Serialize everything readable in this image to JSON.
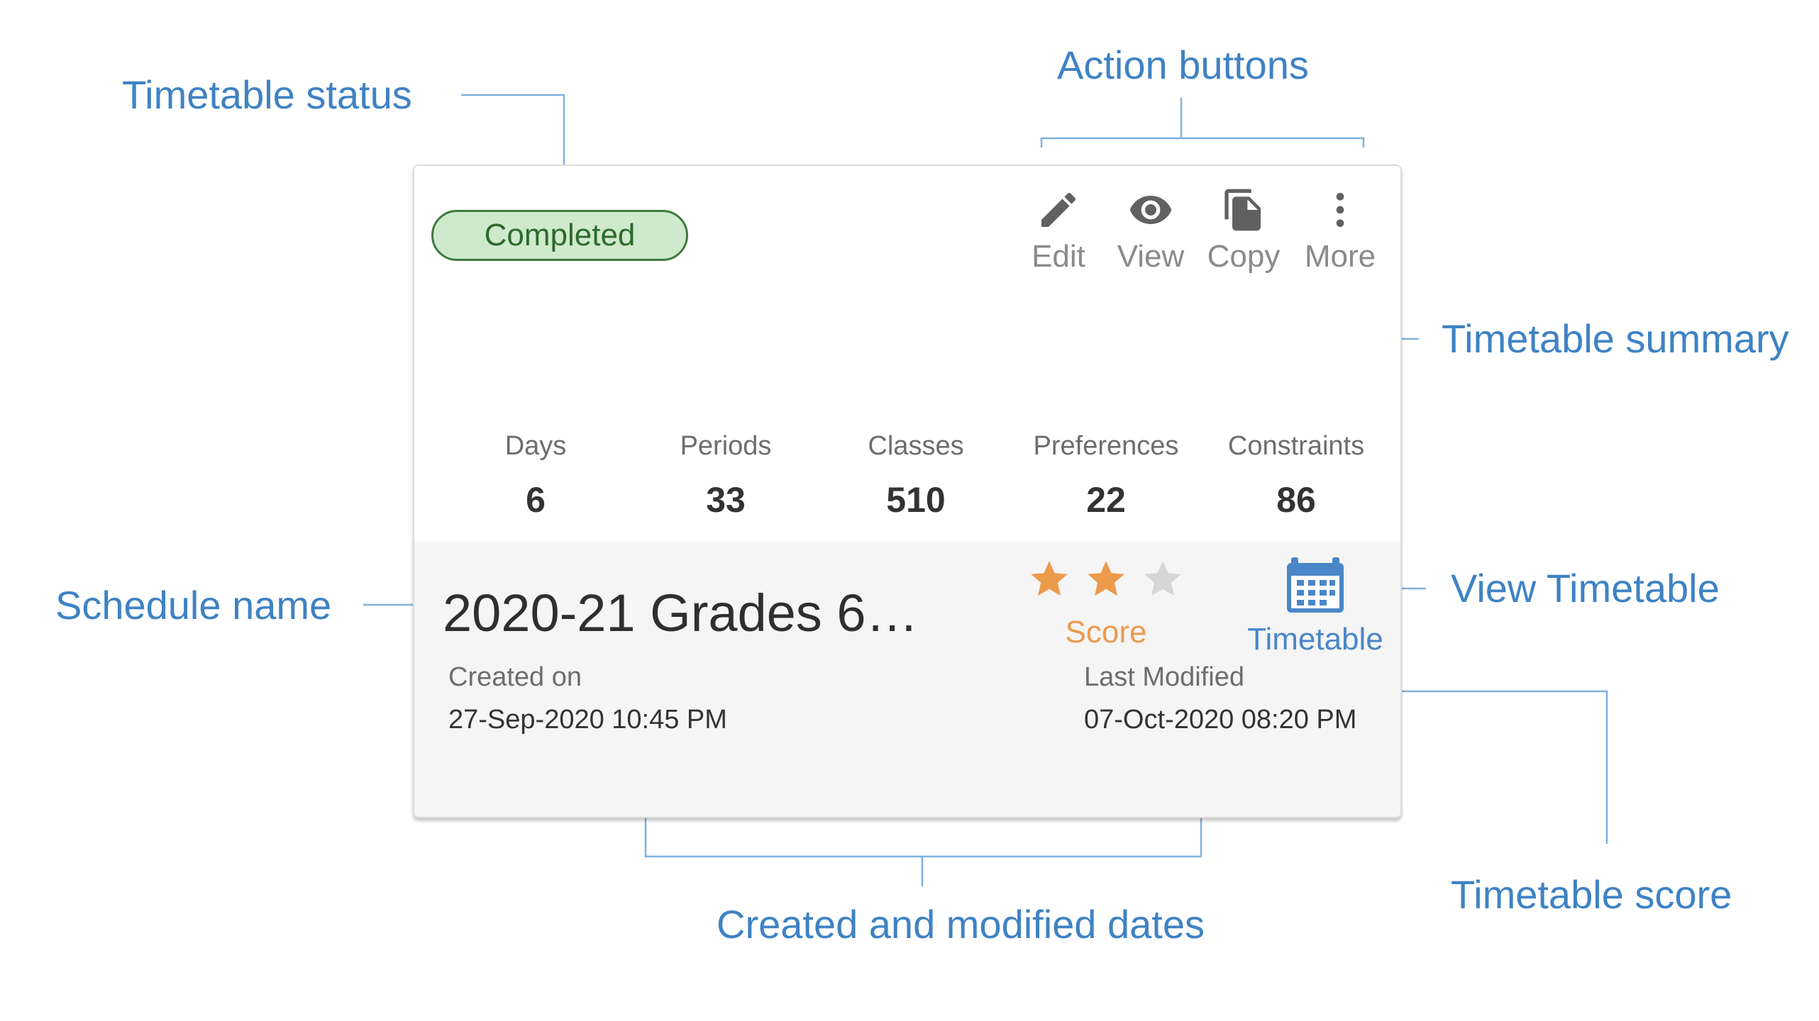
{
  "callouts": {
    "timetable_status": "Timetable status",
    "action_buttons": "Action buttons",
    "timetable_summary": "Timetable summary",
    "schedule_name": "Schedule name",
    "view_timetable": "View Timetable",
    "timetable_score": "Timetable score",
    "created_modified": "Created and modified dates"
  },
  "card": {
    "status": "Completed",
    "status_colors": {
      "fill": "#cfe9cd",
      "border": "#3f7a3f",
      "text": "#2e6a2e"
    },
    "actions": [
      {
        "label": "Edit",
        "icon": "pencil-icon"
      },
      {
        "label": "View",
        "icon": "eye-icon"
      },
      {
        "label": "Copy",
        "icon": "copy-icon"
      },
      {
        "label": "More",
        "icon": "more-vertical-icon"
      }
    ],
    "summary": [
      {
        "label": "Days",
        "value": "6"
      },
      {
        "label": "Periods",
        "value": "33"
      },
      {
        "label": "Classes",
        "value": "510"
      },
      {
        "label": "Preferences",
        "value": "22"
      },
      {
        "label": "Constraints",
        "value": "86"
      }
    ],
    "schedule_name": "2020-21 Grades 6…",
    "score": {
      "label": "Score",
      "rating": 2,
      "max": 3,
      "color": "#ec9a4c"
    },
    "timetable": {
      "label": "Timetable",
      "icon": "calendar-icon",
      "color": "#4a86c8"
    },
    "created": {
      "label": "Created on",
      "value": "27-Sep-2020 10:45 PM"
    },
    "modified": {
      "label": "Last Modified",
      "value": "07-Oct-2020 08:20 PM"
    }
  }
}
